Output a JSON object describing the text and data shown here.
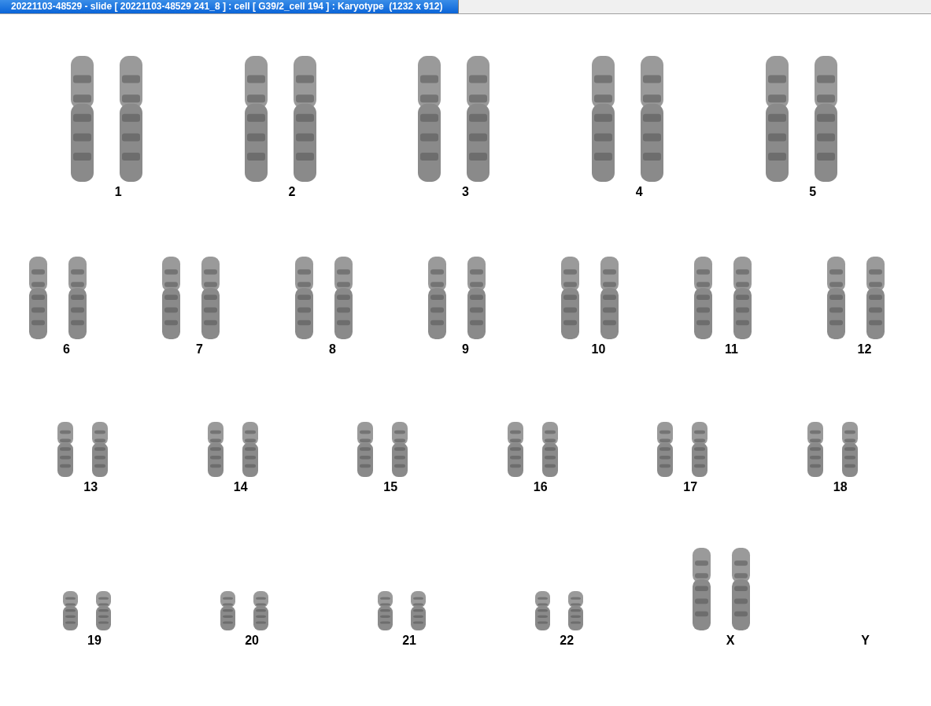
{
  "window": {
    "title": "20221103-48529 - slide [ 20221103-48529 241_8 ] : cell [ G39/2_cell 194 ] : Karyotype  (1232 x 912)"
  },
  "karyotype": {
    "rows": [
      {
        "groups": [
          {
            "label": "1",
            "kind": "large"
          },
          {
            "label": "2",
            "kind": "large"
          },
          {
            "label": "3",
            "kind": "large"
          },
          {
            "label": "4",
            "kind": "large"
          },
          {
            "label": "5",
            "kind": "large"
          }
        ]
      },
      {
        "groups": [
          {
            "label": "6",
            "kind": "medium"
          },
          {
            "label": "7",
            "kind": "medium"
          },
          {
            "label": "8",
            "kind": "medium"
          },
          {
            "label": "9",
            "kind": "medium"
          },
          {
            "label": "10",
            "kind": "medium"
          },
          {
            "label": "11",
            "kind": "medium"
          },
          {
            "label": "12",
            "kind": "medium"
          }
        ]
      },
      {
        "groups": [
          {
            "label": "13",
            "kind": "small"
          },
          {
            "label": "14",
            "kind": "small"
          },
          {
            "label": "15",
            "kind": "small"
          },
          {
            "label": "16",
            "kind": "small"
          },
          {
            "label": "17",
            "kind": "small"
          },
          {
            "label": "18",
            "kind": "small"
          }
        ]
      },
      {
        "groups": [
          {
            "label": "19",
            "kind": "tiny"
          },
          {
            "label": "20",
            "kind": "tiny"
          },
          {
            "label": "21",
            "kind": "tiny"
          },
          {
            "label": "22",
            "kind": "tiny"
          },
          {
            "label": "X",
            "kind": "medium"
          },
          {
            "label": "Y",
            "kind": "none"
          }
        ]
      }
    ]
  }
}
